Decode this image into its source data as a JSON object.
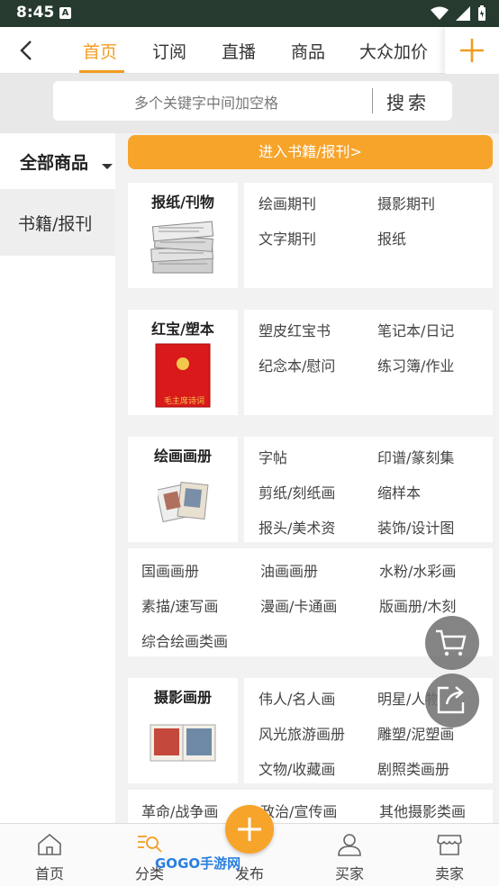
{
  "status": {
    "time": "8:45",
    "notif_icon": "A"
  },
  "topnav": {
    "tabs": [
      {
        "label": "首页",
        "active": true
      },
      {
        "label": "订阅",
        "active": false
      },
      {
        "label": "直播",
        "active": false
      },
      {
        "label": "商品",
        "active": false
      },
      {
        "label": "大众加价",
        "active": false
      }
    ]
  },
  "search": {
    "placeholder": "多个关键字中间加空格",
    "button": "搜索"
  },
  "sidebar": {
    "all_label": "全部商品",
    "items": [
      {
        "label": "书籍/报刊"
      }
    ]
  },
  "enter_button": "进入书籍/报刊>",
  "categories": [
    {
      "title": "报纸/刊物",
      "subs": [
        "绘画期刊",
        "摄影期刊",
        "文字期刊",
        "报纸"
      ],
      "extra": []
    },
    {
      "title": "红宝/塑本",
      "subs": [
        "塑皮红宝书",
        "笔记本/日记",
        "纪念本/慰问",
        "练习簿/作业"
      ],
      "extra": []
    },
    {
      "title": "绘画画册",
      "subs": [
        "字帖",
        "印谱/篆刻集",
        "剪纸/刻纸画",
        "缩样本",
        "报头/美术资",
        "装饰/设计图"
      ],
      "extra": [
        "国画画册",
        "油画画册",
        "水粉/水彩画",
        "素描/速写画",
        "漫画/卡通画",
        "版画册/木刻",
        "综合绘画类画"
      ]
    },
    {
      "title": "摄影画册",
      "subs": [
        "伟人/名人画",
        "明星/人物",
        "风光旅游画册",
        "雕塑/泥塑画",
        "文物/收藏画",
        "剧照类画册"
      ],
      "extra": [
        "革命/战争画",
        "政治/宣传画",
        "其他摄影类画"
      ]
    }
  ],
  "book_cover_text": "毛主席诗词",
  "bottomnav": {
    "items": [
      {
        "label": "首页",
        "icon": "home-icon"
      },
      {
        "label": "分类",
        "icon": "category-icon"
      },
      {
        "label": "发布",
        "icon": "plus-icon"
      },
      {
        "label": "买家",
        "icon": "user-icon"
      },
      {
        "label": "卖家",
        "icon": "shop-icon"
      }
    ]
  },
  "watermark": "GOGO手游网",
  "colors": {
    "accent": "#f29c1f",
    "button": "#f7a42b",
    "statusbar": "#263a2f"
  }
}
